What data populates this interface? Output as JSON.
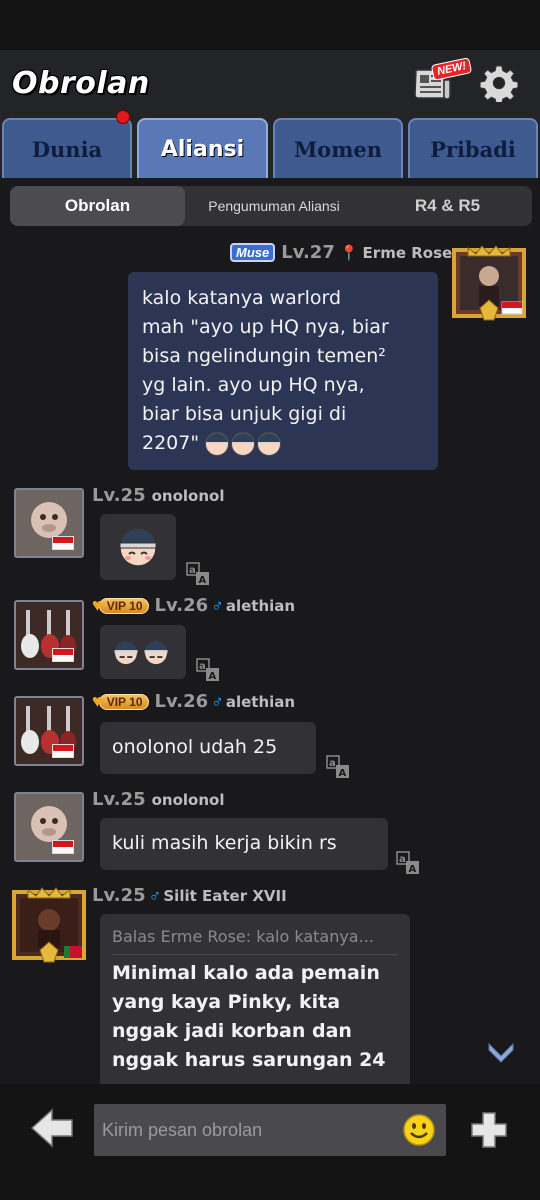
{
  "header": {
    "title": "Obrolan",
    "news_badge": "NEW!"
  },
  "tabs": [
    {
      "label": "Dunia",
      "active": false
    },
    {
      "label": "Aliansi",
      "active": true
    },
    {
      "label": "Momen",
      "active": false
    },
    {
      "label": "Pribadi",
      "active": false
    }
  ],
  "subtabs": [
    {
      "label": "Obrolan",
      "active": true
    },
    {
      "label": "Pengumuman Aliansi",
      "active": false
    },
    {
      "label": "R4 & R5",
      "active": false
    }
  ],
  "messages": [
    {
      "badge": "Muse",
      "level": "Lv.27",
      "name": "Erme Rose",
      "lines": [
        "kalo katanya warlord",
        "mah \"ayo up HQ nya, biar",
        "bisa ngelindungin temen²",
        "yg lain. ayo up HQ nya,",
        "biar bisa unjuk gigi di",
        "2207\""
      ]
    },
    {
      "level": "Lv.25",
      "name": "onolonol"
    },
    {
      "vip": "VIP 10",
      "level": "Lv.26",
      "name": "alethian"
    },
    {
      "vip": "VIP 10",
      "level": "Lv.26",
      "name": "alethian",
      "text": "onolonol udah 25"
    },
    {
      "level": "Lv.25",
      "name": "onolonol",
      "text": "kuli masih kerja bikin rs"
    },
    {
      "level": "Lv.25",
      "name": "Silit Eater XVII",
      "reply": "Balas Erme Rose: kalo katanya...",
      "lines": [
        "Minimal kalo ada pemain",
        "yang kaya Pinky, kita",
        "nggak jadi korban dan",
        "nggak harus sarungan 24"
      ]
    }
  ],
  "input": {
    "placeholder": "Kirim pesan obrolan"
  },
  "colors": {
    "background": "#19191b",
    "self_bubble": "#2c3654",
    "other_bubble": "#323236",
    "tab_active": "#5a78b5",
    "tab_inactive": "#3e5a8e"
  }
}
